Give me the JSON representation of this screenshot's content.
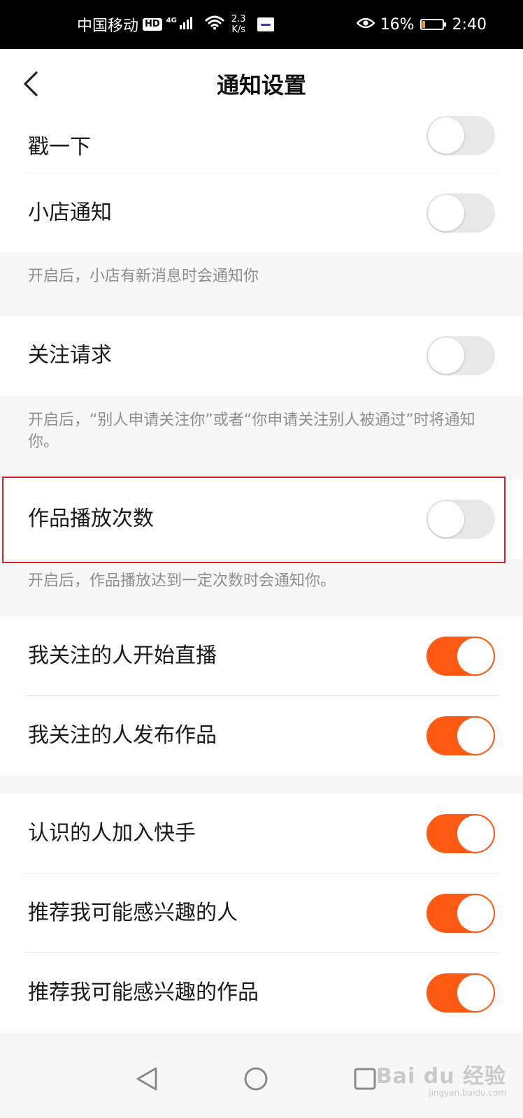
{
  "status_bar": {
    "carrier": "中国移动",
    "hd_badge": "HD",
    "network": "4G",
    "speed_value": "2.3",
    "speed_unit": "K/s",
    "battery_percent": "16%",
    "battery_level": 0.16,
    "time": "2:40",
    "icons": [
      "signal-icon",
      "wifi-icon",
      "app-notification-icon",
      "eye-comfort-icon",
      "battery-icon"
    ]
  },
  "header": {
    "title": "通知设置",
    "back_icon": "chevron-left-icon"
  },
  "settings": {
    "poke": {
      "label": "戳一下",
      "enabled": false
    },
    "shop": {
      "label": "小店通知",
      "enabled": false,
      "note": "开启后，小店有新消息时会通知你"
    },
    "follow_request": {
      "label": "关注请求",
      "enabled": false,
      "note": "开启后，“别人申请关注你”或者“你申请关注别人被通过”时将通知你。"
    },
    "play_count": {
      "label": "作品播放次数",
      "enabled": false,
      "note": "开启后，作品播放达到一定次数时会通知你。"
    },
    "following_live": {
      "label": "我关注的人开始直播",
      "enabled": true
    },
    "following_post": {
      "label": "我关注的人发布作品",
      "enabled": true
    },
    "friends_join": {
      "label": "认识的人加入快手",
      "enabled": true
    },
    "recommend_people": {
      "label": "推荐我可能感兴趣的人",
      "enabled": true
    },
    "recommend_works": {
      "label": "推荐我可能感兴趣的作品",
      "enabled": true
    }
  },
  "colors": {
    "accent": "#ff5a14",
    "toggle_off": "#e8e8e8",
    "highlight_border": "#e02020"
  },
  "watermark": {
    "main": "Bai du 经验",
    "sub": "jingyan.baidu.com"
  },
  "nav_bar": {
    "icons": [
      "back-triangle-icon",
      "home-circle-icon",
      "recents-square-icon"
    ]
  }
}
